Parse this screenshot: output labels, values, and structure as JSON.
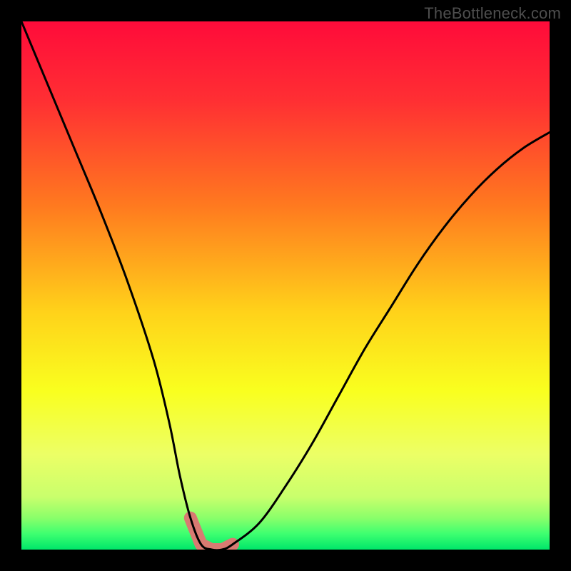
{
  "watermark": "TheBottleneck.com",
  "chart_data": {
    "type": "line",
    "title": "",
    "xlabel": "",
    "ylabel": "",
    "xlim": [
      0,
      100
    ],
    "ylim": [
      0,
      100
    ],
    "series": [
      {
        "name": "bottleneck-curve",
        "x": [
          0,
          5,
          10,
          15,
          20,
          25,
          28,
          30,
          32,
          34,
          36,
          38,
          40,
          45,
          50,
          55,
          60,
          65,
          70,
          75,
          80,
          85,
          90,
          95,
          100
        ],
        "y": [
          100,
          88,
          76,
          64,
          51,
          36,
          24,
          14,
          6,
          1,
          0,
          0,
          1,
          5,
          12,
          20,
          29,
          38,
          46,
          54,
          61,
          67,
          72,
          76,
          79
        ]
      }
    ],
    "highlight_band": {
      "x_start": 30,
      "x_end": 40,
      "y_max": 8
    },
    "gradient_stops": [
      {
        "pct": 0,
        "color": "#ff0b3a"
      },
      {
        "pct": 15,
        "color": "#ff2f33"
      },
      {
        "pct": 35,
        "color": "#ff7a1f"
      },
      {
        "pct": 55,
        "color": "#ffd21a"
      },
      {
        "pct": 70,
        "color": "#f9ff1f"
      },
      {
        "pct": 82,
        "color": "#ecff66"
      },
      {
        "pct": 90,
        "color": "#c9ff6c"
      },
      {
        "pct": 94,
        "color": "#8aff6a"
      },
      {
        "pct": 97,
        "color": "#3eff70"
      },
      {
        "pct": 100,
        "color": "#00e66a"
      }
    ],
    "curve_color": "#000000",
    "highlight_color": "#d87a72"
  }
}
